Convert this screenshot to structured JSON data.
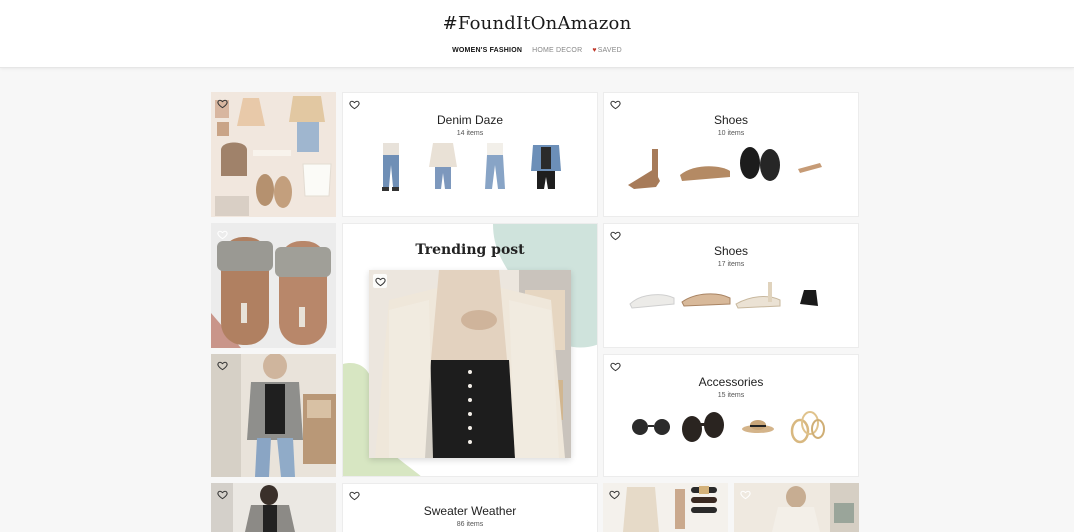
{
  "header": {
    "brand": "#FoundItOnAmazon",
    "nav": {
      "womens_fashion": "WOMEN'S FASHION",
      "home_decor": "HOME DECOR",
      "saved": "SAVED"
    }
  },
  "cards": {
    "denim": {
      "title": "Denim Daze",
      "count": "14 items"
    },
    "shoes1": {
      "title": "Shoes",
      "count": "10 items"
    },
    "trending": {
      "title": "Trending post"
    },
    "shoes2": {
      "title": "Shoes",
      "count": "17 items"
    },
    "accessories": {
      "title": "Accessories",
      "count": "15 items"
    },
    "sweater": {
      "title": "Sweater Weather",
      "count": "86 items"
    }
  },
  "colors": {
    "saved_heart": "#c0392b",
    "trending_mint": "#cfe3dc",
    "trending_lime": "#d7e6c2"
  },
  "icons": {
    "heart": "heart-outline-icon"
  }
}
